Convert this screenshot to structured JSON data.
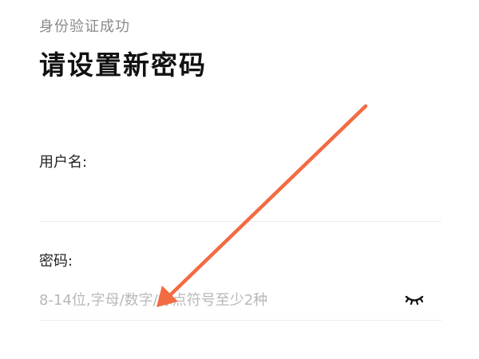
{
  "header": {
    "subtitle": "身份验证成功",
    "title": "请设置新密码"
  },
  "form": {
    "username": {
      "label": "用户名:",
      "value": "",
      "placeholder": ""
    },
    "password": {
      "label": "密码:",
      "value": "",
      "placeholder": "8-14位,字母/数字/标点符号至少2种",
      "toggle_icon": "eye-closed-icon"
    }
  },
  "colors": {
    "annotation_arrow": "#f26b43",
    "placeholder": "#b8b8b8",
    "divider": "#ececec"
  }
}
